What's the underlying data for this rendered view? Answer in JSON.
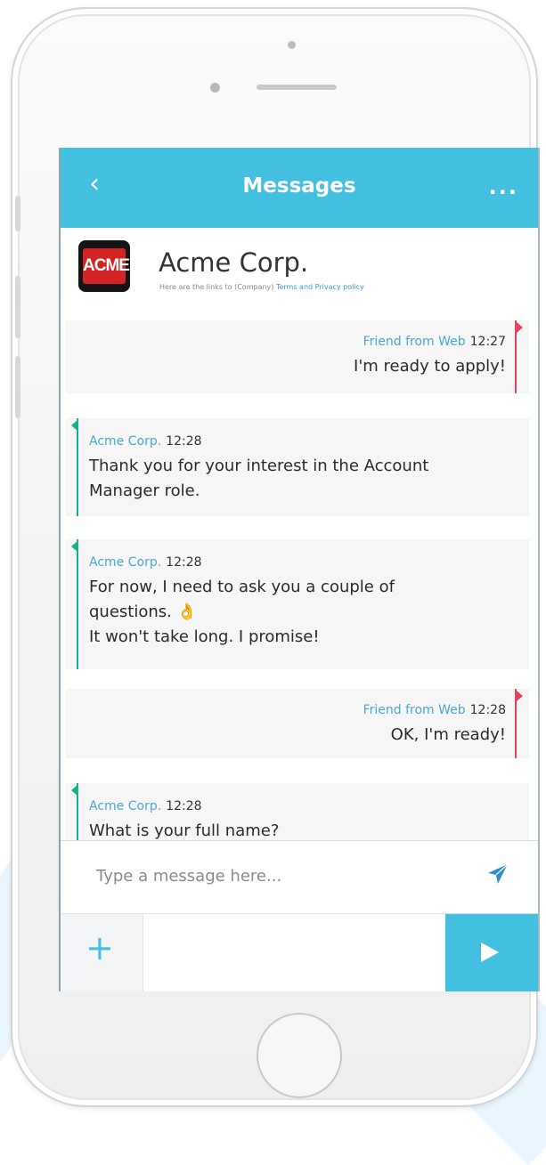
{
  "topbar": {
    "title": "Messages",
    "back_icon": "chevron-left-icon",
    "more_icon": "ellipsis-icon",
    "accent_color": "#43bfe0"
  },
  "company": {
    "logo_text": "ACME",
    "name": "Acme Corp.",
    "subtitle_prefix": "Here are the links to (Company)",
    "terms_link": "Terms and Privacy policy"
  },
  "messages": [
    {
      "direction": "out",
      "sender": "Friend from Web",
      "time": "12:27",
      "lines": [
        "I'm ready to apply!"
      ]
    },
    {
      "direction": "in",
      "sender": "Acme Corp.",
      "time": "12:28",
      "lines": [
        "Thank you for your interest in the Account",
        "Manager role."
      ]
    },
    {
      "direction": "in",
      "sender": "Acme Corp.",
      "time": "12:28",
      "lines": [
        "For now, I need to ask you a couple of",
        "questions. 👌",
        "It won't take long. I promise!"
      ]
    },
    {
      "direction": "out",
      "sender": "Friend from Web",
      "time": "12:28",
      "lines": [
        "OK, I'm ready!"
      ]
    },
    {
      "direction": "in",
      "sender": "Acme Corp.",
      "time": "12:28",
      "lines": [
        "What is your full name?"
      ]
    }
  ],
  "composer": {
    "placeholder": "Type a message here...",
    "send_icon": "paper-plane-icon"
  },
  "bottombar": {
    "plus_label": "+",
    "send_icon": "play-triangle-icon"
  }
}
